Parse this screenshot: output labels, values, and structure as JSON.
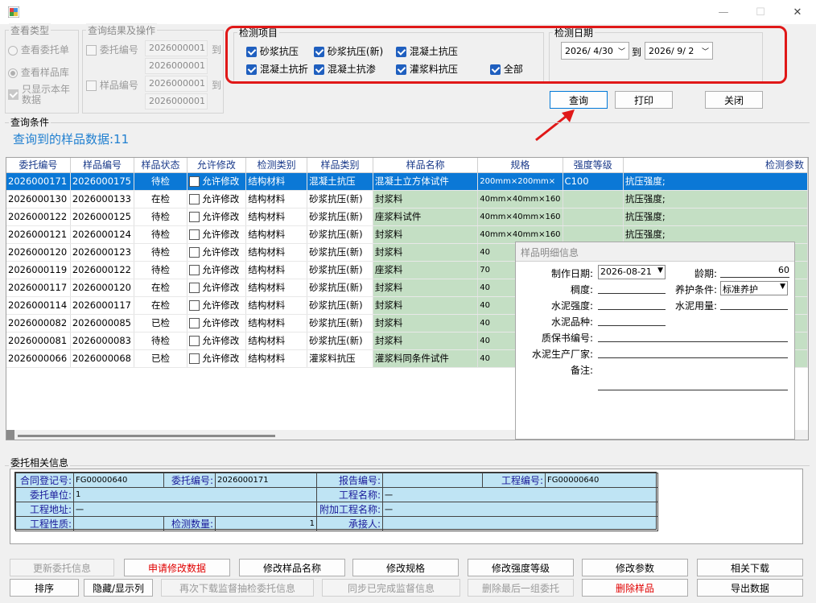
{
  "window": {
    "minimize": "—",
    "maximize": "☐",
    "close": "✕"
  },
  "view_type": {
    "title": "查看类型",
    "opt1": "查看委托单",
    "opt2": "查看样品库",
    "opt3": "只显示本年数据"
  },
  "query_ops": {
    "title": "查询结果及操作",
    "commission_no_label": "委托编号",
    "sample_no_label": "样品编号",
    "to": "到",
    "c_from": "2026000001",
    "c_to": "2026000001",
    "s_from": "2026000001",
    "s_to": "2026000001"
  },
  "test_items": {
    "title": "检测项目",
    "items": [
      "砂浆抗压",
      "砂浆抗压(新)",
      "混凝土抗压",
      "混凝土抗折",
      "混凝土抗渗",
      "灌浆料抗压",
      "全部"
    ]
  },
  "test_date": {
    "title": "检测日期",
    "from": "2026/ 4/30",
    "to_label": "到",
    "to": "2026/ 9/ 2"
  },
  "buttons": {
    "query": "查询",
    "print": "打印",
    "close": "关闭"
  },
  "query_cond": {
    "title": "查询条件",
    "count_text": "查询到的样品数据:11"
  },
  "table": {
    "headers": [
      "委托编号",
      "样品编号",
      "样品状态",
      "允许修改",
      "检测类别",
      "样品类别",
      "样品名称",
      "规格",
      "强度等级",
      "检测参数"
    ],
    "allow_label": "允许修改",
    "rows": [
      [
        "2026000171",
        "2026000175",
        "待检",
        "结构材料",
        "混凝土抗压",
        "混凝土立方体试件",
        "200mm×200mm×",
        "C100",
        "抗压强度;"
      ],
      [
        "2026000130",
        "2026000133",
        "在检",
        "结构材料",
        "砂浆抗压(新)",
        "封浆料",
        "40mm×40mm×160",
        "",
        "抗压强度;"
      ],
      [
        "2026000122",
        "2026000125",
        "待检",
        "结构材料",
        "砂浆抗压(新)",
        "座浆料试件",
        "40mm×40mm×160",
        "",
        "抗压强度;"
      ],
      [
        "2026000121",
        "2026000124",
        "待检",
        "结构材料",
        "砂浆抗压(新)",
        "封浆料",
        "40mm×40mm×160",
        "",
        "抗压强度;"
      ],
      [
        "2026000120",
        "2026000123",
        "待检",
        "结构材料",
        "砂浆抗压(新)",
        "封浆料",
        "40",
        "",
        ""
      ],
      [
        "2026000119",
        "2026000122",
        "待检",
        "结构材料",
        "砂浆抗压(新)",
        "座浆料",
        "70",
        "",
        ""
      ],
      [
        "2026000117",
        "2026000120",
        "在检",
        "结构材料",
        "砂浆抗压(新)",
        "封浆料",
        "40",
        "",
        ""
      ],
      [
        "2026000114",
        "2026000117",
        "在检",
        "结构材料",
        "砂浆抗压(新)",
        "封浆料",
        "40",
        "",
        ""
      ],
      [
        "2026000082",
        "2026000085",
        "已检",
        "结构材料",
        "砂浆抗压(新)",
        "封浆料",
        "40",
        "",
        ""
      ],
      [
        "2026000081",
        "2026000083",
        "待检",
        "结构材料",
        "砂浆抗压(新)",
        "封浆料",
        "40",
        "",
        ""
      ],
      [
        "2026000066",
        "2026000068",
        "已检",
        "结构材料",
        "灌浆料抗压",
        "灌浆料同条件试件",
        "40",
        "",
        ""
      ]
    ]
  },
  "detail": {
    "title": "样品明细信息",
    "make_date_label": "制作日期:",
    "make_date": "2026-08-21",
    "age_label": "龄期:",
    "age": "60",
    "consistency_label": "稠度:",
    "curing_label": "养护条件:",
    "curing": "标准养护",
    "cement_strength_label": "水泥强度:",
    "cement_amount_label": "水泥用量:",
    "cement_type_label": "水泥品种:",
    "cert_label": "质保书编号:",
    "maker_label": "水泥生产厂家:",
    "note_label": "备注:"
  },
  "commission_info": {
    "title": "委托相关信息",
    "contract_label": "合同登记号:",
    "contract": "FG00000640",
    "cno_label": "委托编号:",
    "cno": "2026000171",
    "report_label": "报告编号:",
    "report": "",
    "project_no_label": "工程编号:",
    "project_no": "FG00000640",
    "unit_label": "委托单位:",
    "unit": "1",
    "project_name_label": "工程名称:",
    "project_name": "一",
    "address_label": "工程地址:",
    "address": "一",
    "extra_name_label": "附加工程名称:",
    "extra_name": "一",
    "nature_label": "工程性质:",
    "nature": "",
    "qty_label": "检测数量:",
    "qty": "1",
    "receiver_label": "承接人:",
    "receiver": ""
  },
  "bottom": {
    "b1": "更新委托信息",
    "b2": "申请修改数据",
    "b3": "修改样品名称",
    "b4": "修改规格",
    "b5": "修改强度等级",
    "b6": "修改参数",
    "b7": "相关下载",
    "b8": "排序",
    "b9": "隐藏/显示列",
    "b10": "再次下载监督抽检委托信息",
    "b11": "同步已完成监督信息",
    "b12": "删除最后一组委托",
    "b13": "删除样品",
    "b14": "导出数据"
  },
  "colors": {
    "accent": "#0078d7",
    "highlight": "#e00000",
    "selection": "#0b78d6",
    "green_cell": "#c4dfc4",
    "info_bg": "#bfe4f4"
  }
}
